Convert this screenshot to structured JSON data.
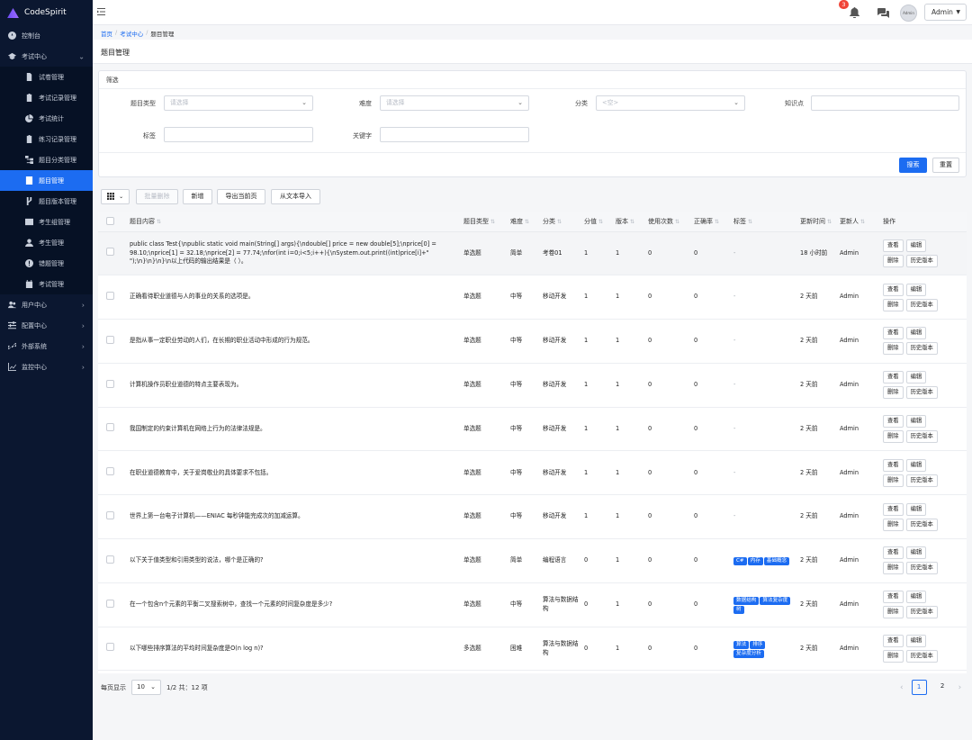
{
  "app": {
    "name": "CodeSpirit"
  },
  "sidebar": {
    "items": [
      {
        "label": "控制台",
        "icon": "dashboard-icon"
      },
      {
        "label": "考试中心",
        "icon": "graduation-cap-icon",
        "expanded": true
      },
      {
        "label": "用户中心",
        "icon": "users-icon"
      },
      {
        "label": "配置中心",
        "icon": "sliders-icon"
      },
      {
        "label": "外部系统",
        "icon": "link-icon"
      },
      {
        "label": "监控中心",
        "icon": "chart-line-icon"
      }
    ],
    "sub_items": [
      {
        "label": "试卷管理"
      },
      {
        "label": "考试记录管理"
      },
      {
        "label": "考试统计"
      },
      {
        "label": "练习记录管理"
      },
      {
        "label": "题目分类管理"
      },
      {
        "label": "题目管理",
        "active": true
      },
      {
        "label": "题目版本管理"
      },
      {
        "label": "考生组管理"
      },
      {
        "label": "考生管理"
      },
      {
        "label": "错题管理"
      },
      {
        "label": "考试管理"
      }
    ]
  },
  "topbar": {
    "notification_count": "3",
    "avatar_text": "Admin",
    "user_label": "Admin"
  },
  "breadcrumb": {
    "home": "首页",
    "section": "考试中心",
    "current": "题目管理",
    "sep": "/"
  },
  "page": {
    "title": "题目管理"
  },
  "filter": {
    "title": "筛选",
    "type_label": "题目类型",
    "type_placeholder": "请选择",
    "difficulty_label": "难度",
    "difficulty_placeholder": "请选择",
    "category_label": "分类",
    "category_placeholder": "<空>",
    "knowledge_label": "知识点",
    "tag_label": "标签",
    "keyword_label": "关键字",
    "search_button": "搜索",
    "reset_button": "重置"
  },
  "toolbar": {
    "batch_delete": "批量删除",
    "add": "新增",
    "export": "导出当前页",
    "import": "从文本导入"
  },
  "table": {
    "headers": [
      "题目内容",
      "题目类型",
      "难度",
      "分类",
      "分值",
      "版本",
      "使用次数",
      "正确率",
      "标签",
      "更新时间",
      "更新人",
      "操作"
    ],
    "op_labels": {
      "view": "查看",
      "edit": "编辑",
      "delete": "删除",
      "history": "历史版本"
    },
    "rows": [
      {
        "content": "public class Test{\\npublic static void main(String[] args){\\ndouble[] price = new double[5];\\nprice[0] = 98.10;\\nprice[1] = 32.18;\\nprice[2] = 77.74;\\nfor(int i=0;i<5;i++){\\nSystem.out.print((int)price[i]+\" \");\\n}\\n}\\n}\\n以上代码的输出结果是（ ）。",
        "type": "单选题",
        "difficulty": "简单",
        "category": "考卷01",
        "score": "1",
        "version": "1",
        "uses": "0",
        "accuracy": "0",
        "tags_text": "-",
        "tags": [],
        "updated": "18 小时前",
        "updater": "Admin"
      },
      {
        "content": "正确看待职业道德与人的事业的关系的选项是。",
        "type": "单选题",
        "difficulty": "中等",
        "category": "移动开发",
        "score": "1",
        "version": "1",
        "uses": "0",
        "accuracy": "0",
        "tags_text": "-",
        "tags": [],
        "updated": "2 天前",
        "updater": "Admin"
      },
      {
        "content": "是指从事一定职业劳动的人们，在长期的职业活动中形成的行为规范。",
        "type": "单选题",
        "difficulty": "中等",
        "category": "移动开发",
        "score": "1",
        "version": "1",
        "uses": "0",
        "accuracy": "0",
        "tags_text": "-",
        "tags": [],
        "updated": "2 天前",
        "updater": "Admin"
      },
      {
        "content": "计算机操作员职业道德的特点主要表现为。",
        "type": "单选题",
        "difficulty": "中等",
        "category": "移动开发",
        "score": "1",
        "version": "1",
        "uses": "0",
        "accuracy": "0",
        "tags_text": "-",
        "tags": [],
        "updated": "2 天前",
        "updater": "Admin"
      },
      {
        "content": "我国制定的约束计算机在网络上行为的法律法规是。",
        "type": "单选题",
        "difficulty": "中等",
        "category": "移动开发",
        "score": "1",
        "version": "1",
        "uses": "0",
        "accuracy": "0",
        "tags_text": "-",
        "tags": [],
        "updated": "2 天前",
        "updater": "Admin"
      },
      {
        "content": "在职业道德教育中，关于爱岗敬业的具体要求不包括。",
        "type": "单选题",
        "difficulty": "中等",
        "category": "移动开发",
        "score": "1",
        "version": "1",
        "uses": "0",
        "accuracy": "0",
        "tags_text": "-",
        "tags": [],
        "updated": "2 天前",
        "updater": "Admin"
      },
      {
        "content": "世界上第一台电子计算机——ENIAC 每秒钟能完成次的加减运算。",
        "type": "单选题",
        "difficulty": "中等",
        "category": "移动开发",
        "score": "1",
        "version": "1",
        "uses": "0",
        "accuracy": "0",
        "tags_text": "-",
        "tags": [],
        "updated": "2 天前",
        "updater": "Admin"
      },
      {
        "content": "以下关于值类型和引用类型的说法，哪个是正确的?",
        "type": "单选题",
        "difficulty": "简单",
        "category": "编程语言",
        "score": "0",
        "version": "1",
        "uses": "0",
        "accuracy": "0",
        "tags_text": "",
        "tags": [
          "C#",
          "内存",
          "基础概念"
        ],
        "updated": "2 天前",
        "updater": "Admin"
      },
      {
        "content": "在一个包含n个元素的平衡二叉搜索树中，查找一个元素的时间复杂度是多少?",
        "type": "单选题",
        "difficulty": "中等",
        "category": "算法与数据结构",
        "score": "0",
        "version": "1",
        "uses": "0",
        "accuracy": "0",
        "tags_text": "",
        "tags": [
          "数据结构",
          "算法复杂度",
          "树"
        ],
        "updated": "2 天前",
        "updater": "Admin"
      },
      {
        "content": "以下哪些排序算法的平均时间复杂度是O(n log n)?",
        "type": "多选题",
        "difficulty": "困难",
        "category": "算法与数据结构",
        "score": "0",
        "version": "1",
        "uses": "0",
        "accuracy": "0",
        "tags_text": "",
        "tags": [
          "算法",
          "排序",
          "复杂度分析"
        ],
        "updated": "2 天前",
        "updater": "Admin"
      }
    ]
  },
  "pagination": {
    "per_page_label": "每页显示",
    "per_page": "10",
    "summary": "1/2 共：12 项",
    "pages": [
      "1",
      "2"
    ],
    "current": "1"
  },
  "colors": {
    "primary": "#1c6cf1",
    "sidebar_bg": "#0b1730",
    "badge": "#f04437"
  }
}
